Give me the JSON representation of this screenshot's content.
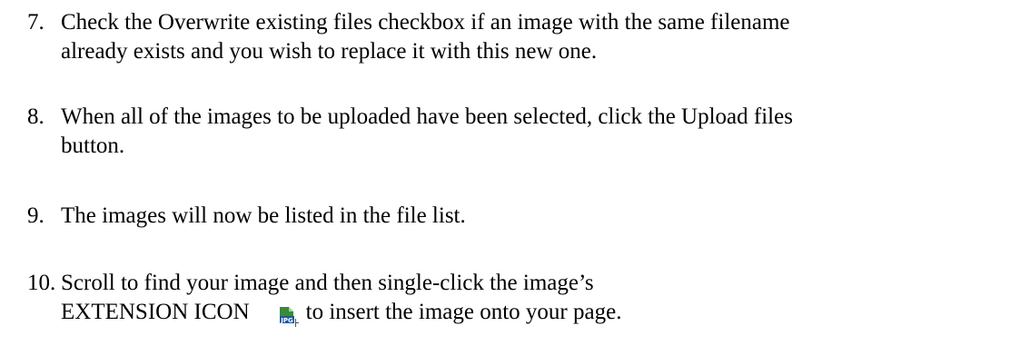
{
  "steps": [
    {
      "number": "7.",
      "line1": "Check the Overwrite existing files checkbox if an image with the same filename",
      "line2": "already exists and you wish to replace it with this new one."
    },
    {
      "number": "8.",
      "line1": "When all of the images to be uploaded have been selected, click the Upload files",
      "line2": "button."
    },
    {
      "number": "9.",
      "line1": "The images will now be listed in the file list."
    },
    {
      "number": "10.",
      "line1": "Scroll to find your image and then single-click the image’s",
      "line2_before_icon": "EXTENSION ICON",
      "line2_after_icon": "to insert the image onto your page.",
      "icon": {
        "name": "jpg-file-icon",
        "label": "JPG",
        "color": "#3a8a3a"
      }
    }
  ]
}
